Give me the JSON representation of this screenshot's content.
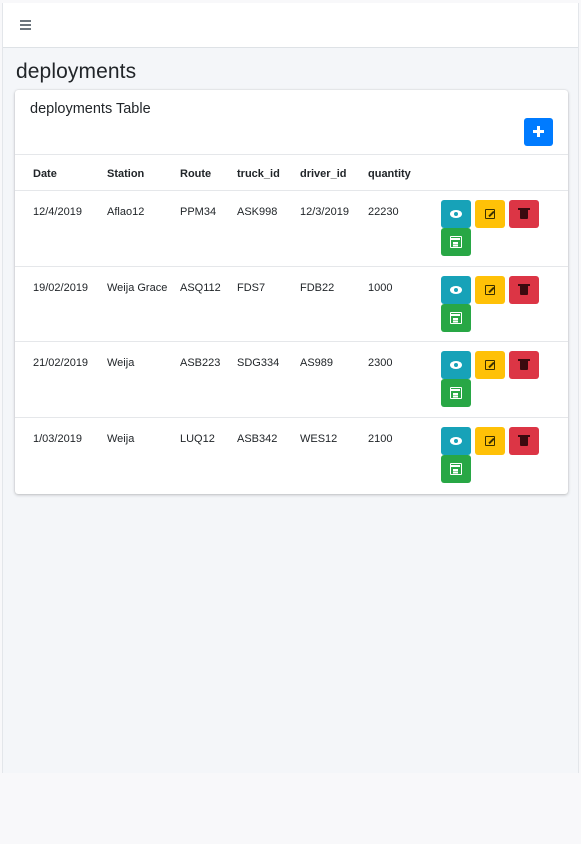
{
  "navbar": {
    "menu_icon": "hamburger-icon"
  },
  "page": {
    "title": "deployments"
  },
  "card": {
    "title": "deployments Table",
    "add_button_icon": "plus-icon"
  },
  "table": {
    "headers": [
      "Date",
      "Station",
      "Route",
      "truck_id",
      "driver_id",
      "quantity"
    ],
    "rows": [
      {
        "date": "12/4/2019",
        "station": "Aflao12",
        "route": "PPM34",
        "truck_id": "ASK998",
        "driver_id": "12/3/2019",
        "quantity": "22230"
      },
      {
        "date": "19/02/2019",
        "station": "Weija Grace",
        "route": "ASQ112",
        "truck_id": "FDS7",
        "driver_id": "FDB22",
        "quantity": "1000"
      },
      {
        "date": "21/02/2019",
        "station": "Weija",
        "route": "ASB223",
        "truck_id": "SDG334",
        "driver_id": "AS989",
        "quantity": "2300"
      },
      {
        "date": "1/03/2019",
        "station": "Weija",
        "route": "LUQ12",
        "truck_id": "ASB342",
        "driver_id": "WES12",
        "quantity": "2100"
      }
    ],
    "actions": [
      {
        "name": "view",
        "icon": "eye-icon",
        "color": "#17a2b8"
      },
      {
        "name": "edit",
        "icon": "edit-icon",
        "color": "#ffc107"
      },
      {
        "name": "delete",
        "icon": "trash-icon",
        "color": "#dc3545"
      },
      {
        "name": "schedule",
        "icon": "calendar-icon",
        "color": "#28a745"
      }
    ]
  },
  "colors": {
    "primary": "#007bff",
    "background": "#f4f6f9"
  }
}
